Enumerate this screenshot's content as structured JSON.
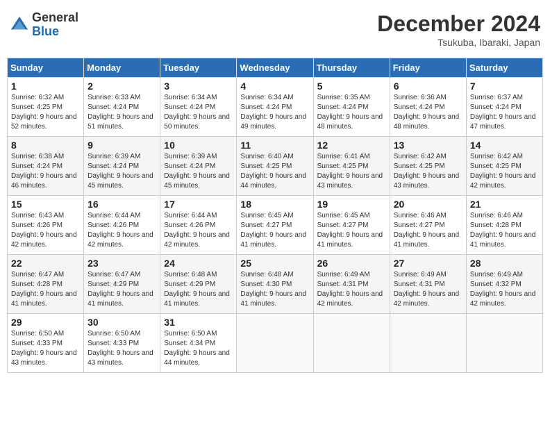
{
  "header": {
    "logo_general": "General",
    "logo_blue": "Blue",
    "month": "December 2024",
    "location": "Tsukuba, Ibaraki, Japan"
  },
  "days_of_week": [
    "Sunday",
    "Monday",
    "Tuesday",
    "Wednesday",
    "Thursday",
    "Friday",
    "Saturday"
  ],
  "weeks": [
    [
      {
        "day": "1",
        "sunrise": "6:32 AM",
        "sunset": "4:25 PM",
        "daylight": "9 hours and 52 minutes."
      },
      {
        "day": "2",
        "sunrise": "6:33 AM",
        "sunset": "4:24 PM",
        "daylight": "9 hours and 51 minutes."
      },
      {
        "day": "3",
        "sunrise": "6:34 AM",
        "sunset": "4:24 PM",
        "daylight": "9 hours and 50 minutes."
      },
      {
        "day": "4",
        "sunrise": "6:34 AM",
        "sunset": "4:24 PM",
        "daylight": "9 hours and 49 minutes."
      },
      {
        "day": "5",
        "sunrise": "6:35 AM",
        "sunset": "4:24 PM",
        "daylight": "9 hours and 48 minutes."
      },
      {
        "day": "6",
        "sunrise": "6:36 AM",
        "sunset": "4:24 PM",
        "daylight": "9 hours and 48 minutes."
      },
      {
        "day": "7",
        "sunrise": "6:37 AM",
        "sunset": "4:24 PM",
        "daylight": "9 hours and 47 minutes."
      }
    ],
    [
      {
        "day": "8",
        "sunrise": "6:38 AM",
        "sunset": "4:24 PM",
        "daylight": "9 hours and 46 minutes."
      },
      {
        "day": "9",
        "sunrise": "6:39 AM",
        "sunset": "4:24 PM",
        "daylight": "9 hours and 45 minutes."
      },
      {
        "day": "10",
        "sunrise": "6:39 AM",
        "sunset": "4:24 PM",
        "daylight": "9 hours and 45 minutes."
      },
      {
        "day": "11",
        "sunrise": "6:40 AM",
        "sunset": "4:25 PM",
        "daylight": "9 hours and 44 minutes."
      },
      {
        "day": "12",
        "sunrise": "6:41 AM",
        "sunset": "4:25 PM",
        "daylight": "9 hours and 43 minutes."
      },
      {
        "day": "13",
        "sunrise": "6:42 AM",
        "sunset": "4:25 PM",
        "daylight": "9 hours and 43 minutes."
      },
      {
        "day": "14",
        "sunrise": "6:42 AM",
        "sunset": "4:25 PM",
        "daylight": "9 hours and 42 minutes."
      }
    ],
    [
      {
        "day": "15",
        "sunrise": "6:43 AM",
        "sunset": "4:26 PM",
        "daylight": "9 hours and 42 minutes."
      },
      {
        "day": "16",
        "sunrise": "6:44 AM",
        "sunset": "4:26 PM",
        "daylight": "9 hours and 42 minutes."
      },
      {
        "day": "17",
        "sunrise": "6:44 AM",
        "sunset": "4:26 PM",
        "daylight": "9 hours and 42 minutes."
      },
      {
        "day": "18",
        "sunrise": "6:45 AM",
        "sunset": "4:27 PM",
        "daylight": "9 hours and 41 minutes."
      },
      {
        "day": "19",
        "sunrise": "6:45 AM",
        "sunset": "4:27 PM",
        "daylight": "9 hours and 41 minutes."
      },
      {
        "day": "20",
        "sunrise": "6:46 AM",
        "sunset": "4:27 PM",
        "daylight": "9 hours and 41 minutes."
      },
      {
        "day": "21",
        "sunrise": "6:46 AM",
        "sunset": "4:28 PM",
        "daylight": "9 hours and 41 minutes."
      }
    ],
    [
      {
        "day": "22",
        "sunrise": "6:47 AM",
        "sunset": "4:28 PM",
        "daylight": "9 hours and 41 minutes."
      },
      {
        "day": "23",
        "sunrise": "6:47 AM",
        "sunset": "4:29 PM",
        "daylight": "9 hours and 41 minutes."
      },
      {
        "day": "24",
        "sunrise": "6:48 AM",
        "sunset": "4:29 PM",
        "daylight": "9 hours and 41 minutes."
      },
      {
        "day": "25",
        "sunrise": "6:48 AM",
        "sunset": "4:30 PM",
        "daylight": "9 hours and 41 minutes."
      },
      {
        "day": "26",
        "sunrise": "6:49 AM",
        "sunset": "4:31 PM",
        "daylight": "9 hours and 42 minutes."
      },
      {
        "day": "27",
        "sunrise": "6:49 AM",
        "sunset": "4:31 PM",
        "daylight": "9 hours and 42 minutes."
      },
      {
        "day": "28",
        "sunrise": "6:49 AM",
        "sunset": "4:32 PM",
        "daylight": "9 hours and 42 minutes."
      }
    ],
    [
      {
        "day": "29",
        "sunrise": "6:50 AM",
        "sunset": "4:33 PM",
        "daylight": "9 hours and 43 minutes."
      },
      {
        "day": "30",
        "sunrise": "6:50 AM",
        "sunset": "4:33 PM",
        "daylight": "9 hours and 43 minutes."
      },
      {
        "day": "31",
        "sunrise": "6:50 AM",
        "sunset": "4:34 PM",
        "daylight": "9 hours and 44 minutes."
      },
      null,
      null,
      null,
      null
    ]
  ]
}
